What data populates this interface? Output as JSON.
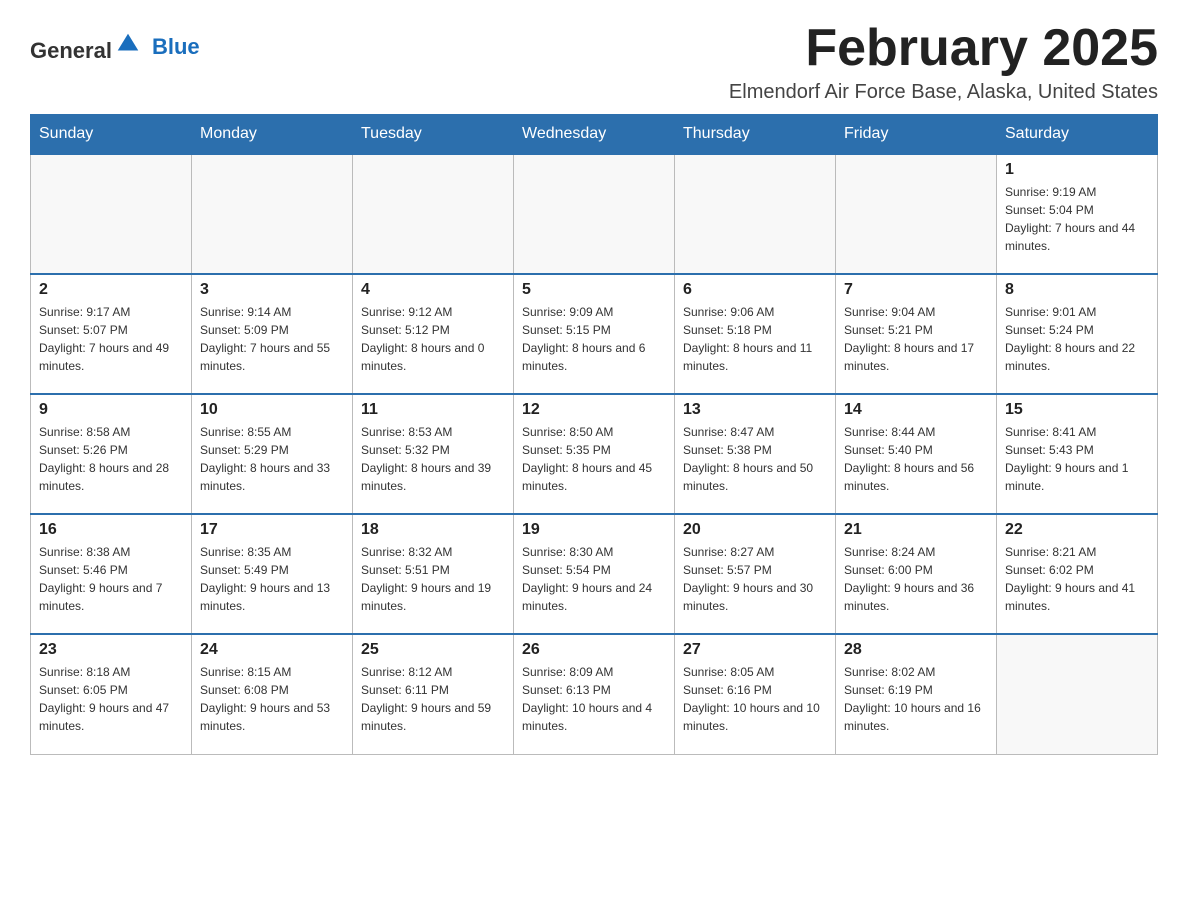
{
  "header": {
    "logo_general": "General",
    "logo_blue": "Blue",
    "title": "February 2025",
    "location": "Elmendorf Air Force Base, Alaska, United States"
  },
  "days_of_week": [
    "Sunday",
    "Monday",
    "Tuesday",
    "Wednesday",
    "Thursday",
    "Friday",
    "Saturday"
  ],
  "weeks": [
    [
      {
        "day": "",
        "info": ""
      },
      {
        "day": "",
        "info": ""
      },
      {
        "day": "",
        "info": ""
      },
      {
        "day": "",
        "info": ""
      },
      {
        "day": "",
        "info": ""
      },
      {
        "day": "",
        "info": ""
      },
      {
        "day": "1",
        "info": "Sunrise: 9:19 AM\nSunset: 5:04 PM\nDaylight: 7 hours and 44 minutes."
      }
    ],
    [
      {
        "day": "2",
        "info": "Sunrise: 9:17 AM\nSunset: 5:07 PM\nDaylight: 7 hours and 49 minutes."
      },
      {
        "day": "3",
        "info": "Sunrise: 9:14 AM\nSunset: 5:09 PM\nDaylight: 7 hours and 55 minutes."
      },
      {
        "day": "4",
        "info": "Sunrise: 9:12 AM\nSunset: 5:12 PM\nDaylight: 8 hours and 0 minutes."
      },
      {
        "day": "5",
        "info": "Sunrise: 9:09 AM\nSunset: 5:15 PM\nDaylight: 8 hours and 6 minutes."
      },
      {
        "day": "6",
        "info": "Sunrise: 9:06 AM\nSunset: 5:18 PM\nDaylight: 8 hours and 11 minutes."
      },
      {
        "day": "7",
        "info": "Sunrise: 9:04 AM\nSunset: 5:21 PM\nDaylight: 8 hours and 17 minutes."
      },
      {
        "day": "8",
        "info": "Sunrise: 9:01 AM\nSunset: 5:24 PM\nDaylight: 8 hours and 22 minutes."
      }
    ],
    [
      {
        "day": "9",
        "info": "Sunrise: 8:58 AM\nSunset: 5:26 PM\nDaylight: 8 hours and 28 minutes."
      },
      {
        "day": "10",
        "info": "Sunrise: 8:55 AM\nSunset: 5:29 PM\nDaylight: 8 hours and 33 minutes."
      },
      {
        "day": "11",
        "info": "Sunrise: 8:53 AM\nSunset: 5:32 PM\nDaylight: 8 hours and 39 minutes."
      },
      {
        "day": "12",
        "info": "Sunrise: 8:50 AM\nSunset: 5:35 PM\nDaylight: 8 hours and 45 minutes."
      },
      {
        "day": "13",
        "info": "Sunrise: 8:47 AM\nSunset: 5:38 PM\nDaylight: 8 hours and 50 minutes."
      },
      {
        "day": "14",
        "info": "Sunrise: 8:44 AM\nSunset: 5:40 PM\nDaylight: 8 hours and 56 minutes."
      },
      {
        "day": "15",
        "info": "Sunrise: 8:41 AM\nSunset: 5:43 PM\nDaylight: 9 hours and 1 minute."
      }
    ],
    [
      {
        "day": "16",
        "info": "Sunrise: 8:38 AM\nSunset: 5:46 PM\nDaylight: 9 hours and 7 minutes."
      },
      {
        "day": "17",
        "info": "Sunrise: 8:35 AM\nSunset: 5:49 PM\nDaylight: 9 hours and 13 minutes."
      },
      {
        "day": "18",
        "info": "Sunrise: 8:32 AM\nSunset: 5:51 PM\nDaylight: 9 hours and 19 minutes."
      },
      {
        "day": "19",
        "info": "Sunrise: 8:30 AM\nSunset: 5:54 PM\nDaylight: 9 hours and 24 minutes."
      },
      {
        "day": "20",
        "info": "Sunrise: 8:27 AM\nSunset: 5:57 PM\nDaylight: 9 hours and 30 minutes."
      },
      {
        "day": "21",
        "info": "Sunrise: 8:24 AM\nSunset: 6:00 PM\nDaylight: 9 hours and 36 minutes."
      },
      {
        "day": "22",
        "info": "Sunrise: 8:21 AM\nSunset: 6:02 PM\nDaylight: 9 hours and 41 minutes."
      }
    ],
    [
      {
        "day": "23",
        "info": "Sunrise: 8:18 AM\nSunset: 6:05 PM\nDaylight: 9 hours and 47 minutes."
      },
      {
        "day": "24",
        "info": "Sunrise: 8:15 AM\nSunset: 6:08 PM\nDaylight: 9 hours and 53 minutes."
      },
      {
        "day": "25",
        "info": "Sunrise: 8:12 AM\nSunset: 6:11 PM\nDaylight: 9 hours and 59 minutes."
      },
      {
        "day": "26",
        "info": "Sunrise: 8:09 AM\nSunset: 6:13 PM\nDaylight: 10 hours and 4 minutes."
      },
      {
        "day": "27",
        "info": "Sunrise: 8:05 AM\nSunset: 6:16 PM\nDaylight: 10 hours and 10 minutes."
      },
      {
        "day": "28",
        "info": "Sunrise: 8:02 AM\nSunset: 6:19 PM\nDaylight: 10 hours and 16 minutes."
      },
      {
        "day": "",
        "info": ""
      }
    ]
  ]
}
